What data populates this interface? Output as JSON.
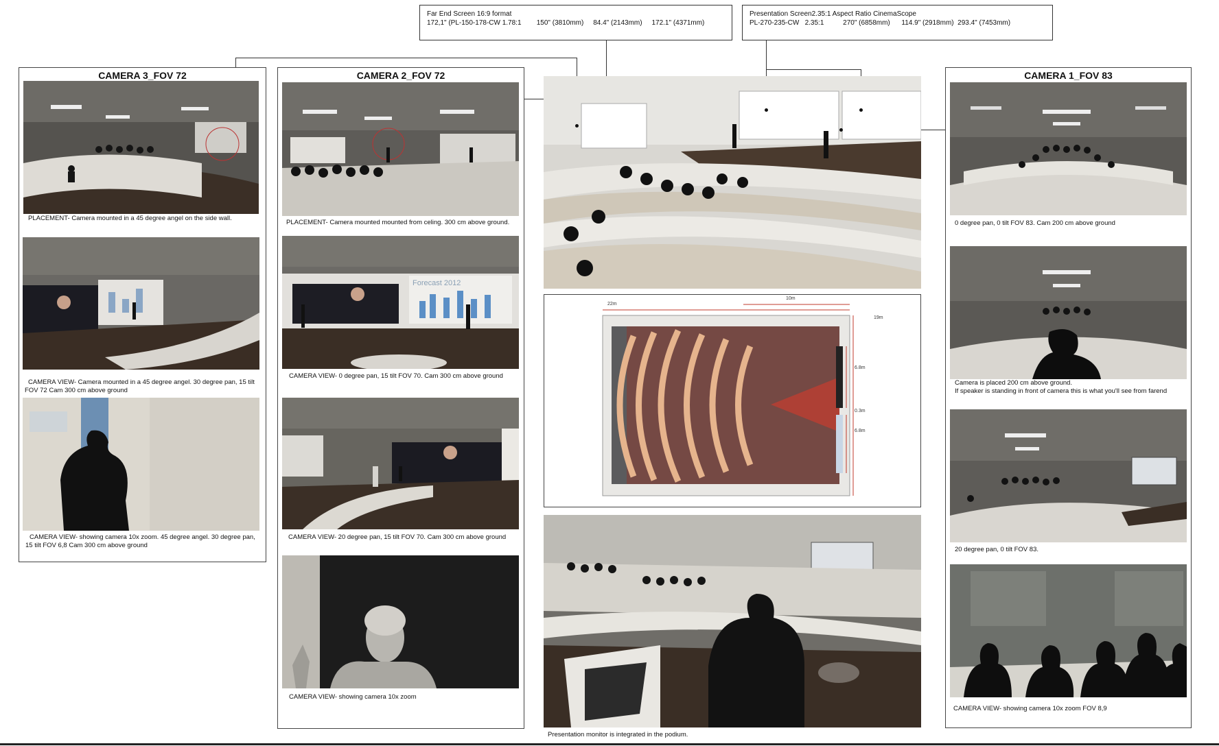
{
  "spec_far_end": {
    "title": "Far End Screen 16:9 format",
    "detail": "172,1\" (PL-150-178-CW 1.78:1        150\" (3810mm)     84.4\" (2143mm)     172.1\" (4371mm)"
  },
  "spec_presentation": {
    "title": "Presentation Screen2.35:1 Aspect Ratio CinemaScope",
    "detail": "PL-270-235-CW   2.35:1          270\" (6858mm)      114.9\" (2918mm)  293.4\" (7453mm)"
  },
  "camera3": {
    "title": "CAMERA 3_FOV 72",
    "captions": [
      "PLACEMENT- Camera mounted in a 45 degree angel on the side wall.",
      "CAMERA VIEW- Camera mounted in a 45 degree angel. 30 degree pan, 15 tilt",
      "FOV 72 Cam 300 cm above ground",
      "CAMERA VIEW- showing camera 10x zoom. 45 degree angel. 30 degree pan,",
      "15 tilt FOV 6,8 Cam 300 cm above ground"
    ]
  },
  "camera2": {
    "title": "CAMERA 2_FOV 72",
    "captions": [
      "PLACEMENT- Camera mounted mounted from celing. 300 cm above ground.",
      "CAMERA VIEW- 0 degree pan, 15 tilt FOV 70. Cam 300 cm above ground",
      "CAMERA VIEW- 20 degree pan, 15 tilt FOV 70. Cam 300 cm above ground",
      "CAMERA VIEW- showing camera 10x zoom"
    ],
    "screen_text": "Forecast 2012"
  },
  "camera1": {
    "title": "CAMERA 1_FOV 83",
    "captions": [
      "0 degree pan, 0 tilt FOV 83. Cam 200 cm above ground",
      "Camera is placed 200 cm above ground.",
      "If speaker is standing in front of camera this is what you'll see from farend",
      "20 degree pan, 0 tilt FOV 83.",
      "CAMERA VIEW- showing camera 10x zoom FOV 8,9"
    ]
  },
  "center": {
    "podium_caption": "Presentation monitor is integrated in the podium.",
    "plan_labels": [
      "22m",
      "10m",
      "19m",
      "6.8m",
      "0.3m",
      "6.8m"
    ]
  },
  "colors": {
    "render_dark": "#3d3a37",
    "render_mid": "#8f8c86",
    "seat_white": "#e8e6e0",
    "floor_wood": "#4a3a2e",
    "red_fov": "#c0392b"
  }
}
